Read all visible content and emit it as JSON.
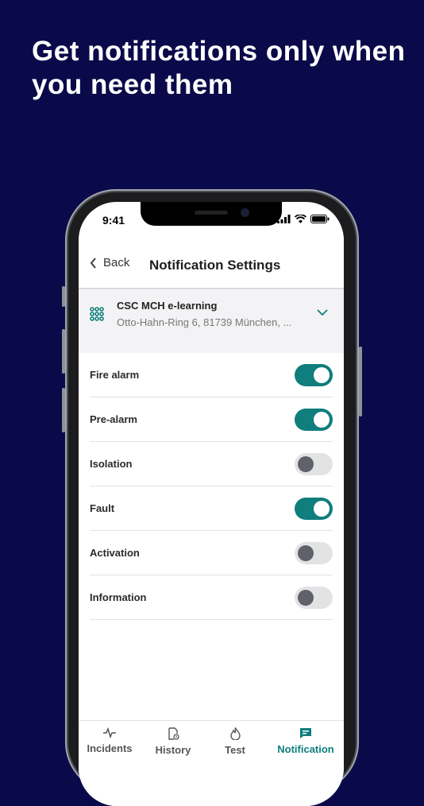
{
  "headline": "Get notifications only when you need them",
  "status_bar": {
    "time": "9:41"
  },
  "nav": {
    "back_label": "Back",
    "title": "Notification Settings"
  },
  "site": {
    "name": "CSC MCH e-learning",
    "address": "Otto-Hahn-Ring 6, 81739 München, ..."
  },
  "settings": [
    {
      "label": "Fire alarm",
      "enabled": true
    },
    {
      "label": "Pre-alarm",
      "enabled": true
    },
    {
      "label": "Isolation",
      "enabled": false
    },
    {
      "label": "Fault",
      "enabled": true
    },
    {
      "label": "Activation",
      "enabled": false
    },
    {
      "label": "Information",
      "enabled": false
    }
  ],
  "tabs": [
    {
      "label": "Incidents",
      "icon": "pulse-icon",
      "active": false
    },
    {
      "label": "History",
      "icon": "history-doc-icon",
      "active": false
    },
    {
      "label": "Test",
      "icon": "flame-icon",
      "active": false
    },
    {
      "label": "Notification",
      "icon": "chat-icon",
      "active": true
    }
  ],
  "colors": {
    "background": "#0a0a4a",
    "accent": "#0f7e7d",
    "toggle_off_track": "#e3e3e6",
    "toggle_off_knob": "#5f6268"
  }
}
